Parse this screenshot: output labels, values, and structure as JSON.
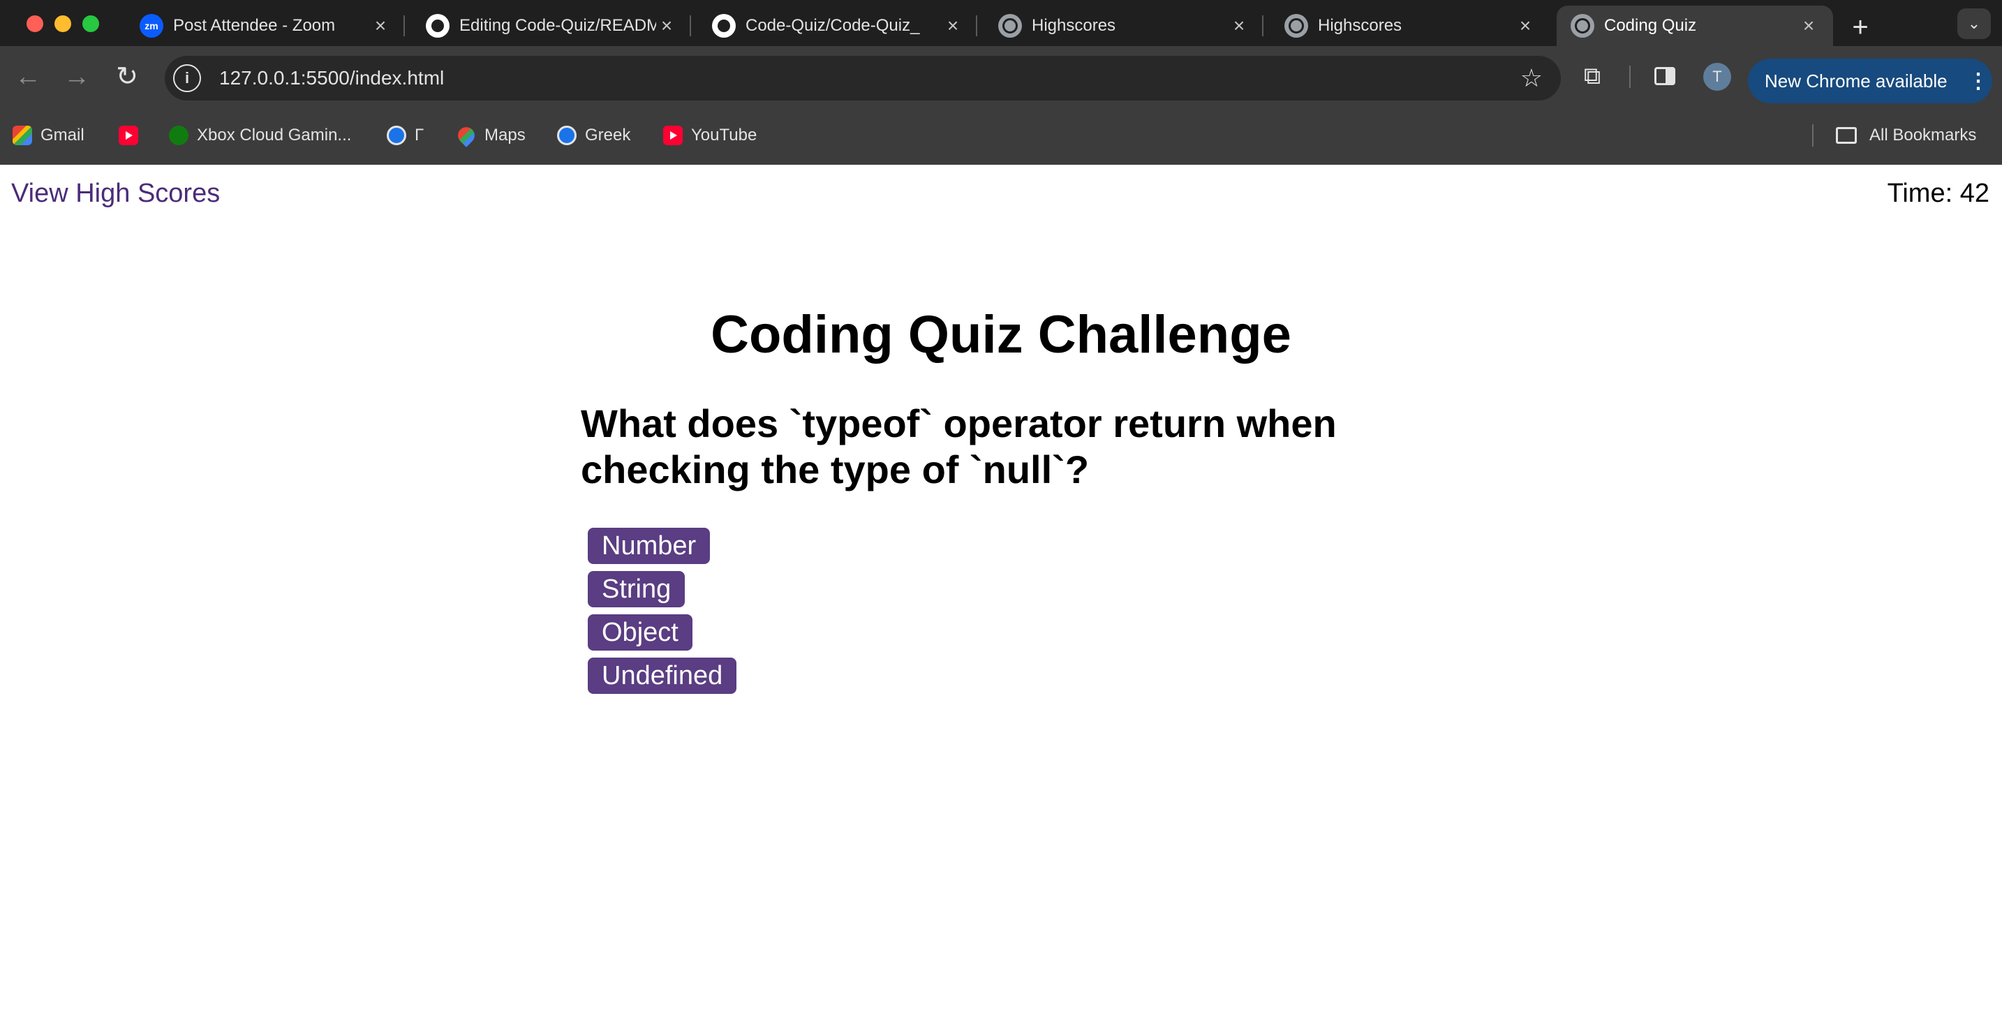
{
  "tabs": [
    {
      "title": "Post Attendee - Zoom",
      "icon": "zoom-icon",
      "icon_text": "zm"
    },
    {
      "title": "Editing Code-Quiz/README",
      "icon": "github-icon"
    },
    {
      "title": "Code-Quiz/Code-Quiz_",
      "icon": "github-icon"
    },
    {
      "title": "Highscores",
      "icon": "globe-icon"
    },
    {
      "title": "Highscores",
      "icon": "globe-icon"
    },
    {
      "title": "Coding Quiz",
      "icon": "globe-icon",
      "active": true
    }
  ],
  "toolbar": {
    "url": "127.0.0.1:5500/index.html",
    "profile_initial": "T",
    "update_label": "New Chrome available"
  },
  "bookmarks": {
    "items": [
      {
        "label": "Gmail",
        "icon": "gmail-icon"
      },
      {
        "label": "",
        "icon": "youtube-icon"
      },
      {
        "label": "Xbox Cloud Gamin...",
        "icon": "xbox-icon"
      },
      {
        "label": "Γ",
        "icon": "greek-site-icon"
      },
      {
        "label": "Maps",
        "icon": "maps-icon"
      },
      {
        "label": "Greek",
        "icon": "greek-site-icon"
      },
      {
        "label": "YouTube",
        "icon": "youtube-icon"
      }
    ],
    "all_bookmarks": "All Bookmarks"
  },
  "page": {
    "view_high_scores": "View High Scores",
    "timer_label": "Time:",
    "timer_value": "42",
    "title": "Coding Quiz Challenge",
    "question": "What does `typeof` operator return when checking the type of `null`?",
    "choices": [
      "Number",
      "String",
      "Object",
      "Undefined"
    ]
  },
  "colors": {
    "accent_purple": "#5a3d82",
    "link_purple": "#4b2c79",
    "chrome_dark": "#1f1f1f",
    "chrome_toolbar": "#3c3c3c",
    "update_chip": "#174a7e"
  }
}
